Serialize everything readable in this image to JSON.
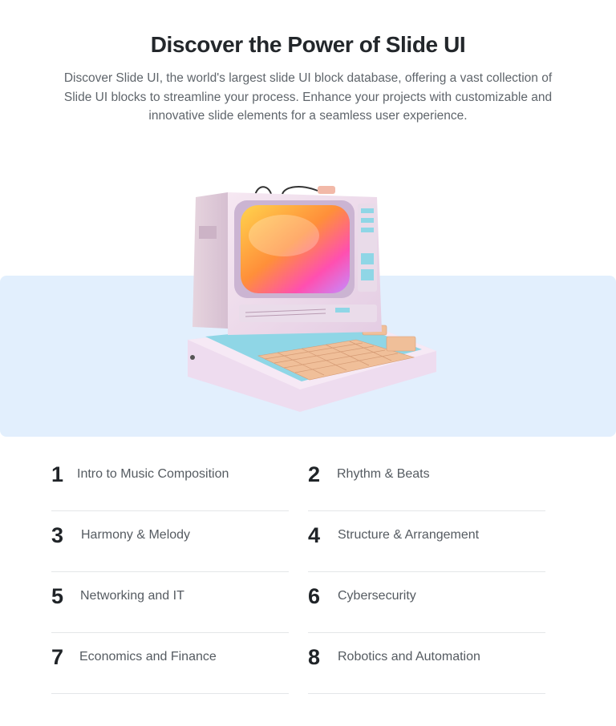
{
  "hero": {
    "title": "Discover the Power of Slide UI",
    "description": "Discover Slide UI, the world's largest slide UI block database, offering a vast collection of Slide UI blocks to streamline your process. Enhance your projects with customizable and innovative slide elements for a seamless user experience."
  },
  "colors": {
    "band": "#e2effd",
    "title": "#23272b",
    "text_muted": "#5f656b",
    "divider": "#e4e6e8"
  },
  "illustration": {
    "icon": "retro-computer-illustration"
  },
  "topics": [
    {
      "number": "1",
      "label": "Intro to Music Composition"
    },
    {
      "number": "2",
      "label": "Rhythm & Beats"
    },
    {
      "number": "3",
      "label": "Harmony & Melody"
    },
    {
      "number": "4",
      "label": "Structure & Arrangement"
    },
    {
      "number": "5",
      "label": "Networking and IT"
    },
    {
      "number": "6",
      "label": "Cybersecurity"
    },
    {
      "number": "7",
      "label": "Economics and Finance"
    },
    {
      "number": "8",
      "label": "Robotics and Automation"
    }
  ]
}
